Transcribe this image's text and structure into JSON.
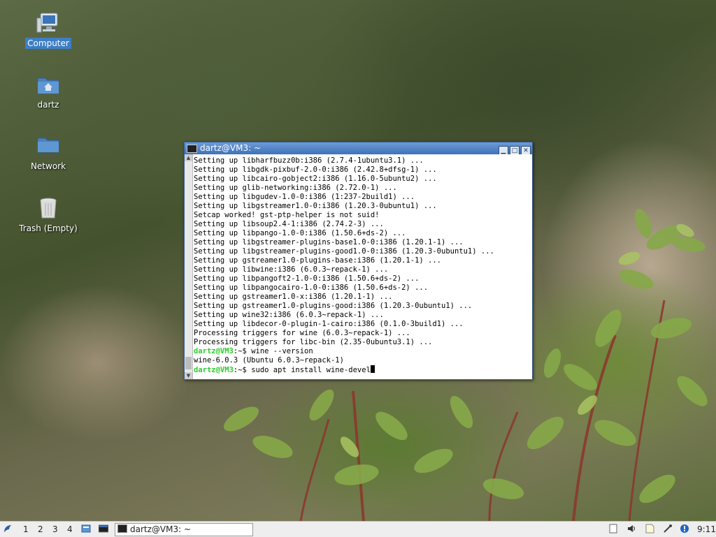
{
  "desktop": {
    "icons": [
      {
        "label": "Computer",
        "selected": true
      },
      {
        "label": "dartz"
      },
      {
        "label": "Network"
      },
      {
        "label": "Trash (Empty)"
      }
    ]
  },
  "terminal": {
    "title": "dartz@VM3: ~",
    "lines": [
      "Setting up libharfbuzz0b:i386 (2.7.4-1ubuntu3.1) ...",
      "Setting up libgdk-pixbuf-2.0-0:i386 (2.42.8+dfsg-1) ...",
      "Setting up libcairo-gobject2:i386 (1.16.0-5ubuntu2) ...",
      "Setting up glib-networking:i386 (2.72.0-1) ...",
      "Setting up libgudev-1.0-0:i386 (1:237-2build1) ...",
      "Setting up libgstreamer1.0-0:i386 (1.20.3-0ubuntu1) ...",
      "Setcap worked! gst-ptp-helper is not suid!",
      "Setting up libsoup2.4-1:i386 (2.74.2-3) ...",
      "Setting up libpango-1.0-0:i386 (1.50.6+ds-2) ...",
      "Setting up libgstreamer-plugins-base1.0-0:i386 (1.20.1-1) ...",
      "Setting up libgstreamer-plugins-good1.0-0:i386 (1.20.3-0ubuntu1) ...",
      "Setting up gstreamer1.0-plugins-base:i386 (1.20.1-1) ...",
      "Setting up libwine:i386 (6.0.3~repack-1) ...",
      "Setting up libpangoft2-1.0-0:i386 (1.50.6+ds-2) ...",
      "Setting up libpangocairo-1.0-0:i386 (1.50.6+ds-2) ...",
      "Setting up gstreamer1.0-x:i386 (1.20.1-1) ...",
      "Setting up gstreamer1.0-plugins-good:i386 (1.20.3-0ubuntu1) ...",
      "Setting up wine32:i386 (6.0.3~repack-1) ...",
      "Setting up libdecor-0-plugin-1-cairo:i386 (0.1.0-3build1) ...",
      "Processing triggers for wine (6.0.3~repack-1) ...",
      "Processing triggers for libc-bin (2.35-0ubuntu3.1) ..."
    ],
    "prompt_user": "dartz@VM3",
    "prompt_suffix": ":~$ ",
    "cmd1": "wine --version",
    "output1": "wine-6.0.3 (Ubuntu 6.0.3~repack-1)",
    "cmd2": "sudo apt install wine-devel"
  },
  "taskbar": {
    "workspaces": [
      "1",
      "2",
      "3",
      "4"
    ],
    "task_label": "dartz@VM3: ~",
    "clock": "9:11"
  }
}
